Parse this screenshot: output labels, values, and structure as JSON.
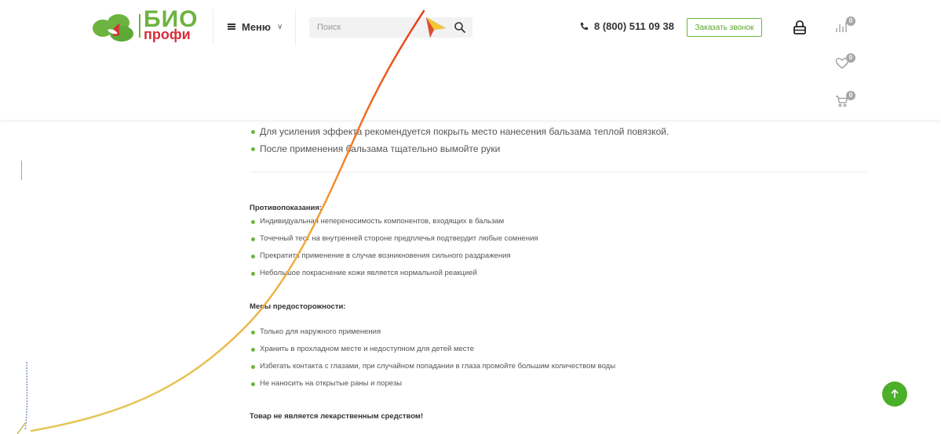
{
  "header": {
    "logo": {
      "top": "БИО",
      "bottom": "профи"
    },
    "menu": {
      "label": "Меню"
    },
    "search": {
      "placeholder": "Поиск"
    },
    "phone": "8 (800) 511 09 38",
    "call_button": "Заказать звонок",
    "compare_count": "0",
    "favorites_count": "0",
    "cart_count": "0"
  },
  "content": {
    "usage_items": [
      "Для усиления эффекта рекомендуется покрыть место нанесения бальзама теплой повязкой.",
      "После применения бальзама тщательно вымойте руки"
    ],
    "contraindications": {
      "title": "Противопоказания:",
      "items": [
        "Индивидуальная непереносимость компонентов, входящих в бальзам",
        "Точечный тест на внутренней стороне предплечья подтвердит любые сомнения",
        "Прекратить применение в случае возникновения сильного раздражения",
        "Небольшое покраснение кожи является нормальной реакцией"
      ]
    },
    "precautions": {
      "title": "Меры предосторожности:",
      "items": [
        "Только для наружного применения",
        "Хранить в прохладном месте и недоступном для детей месте",
        "Избегать контакта с глазами, при случайном попадании в глаза промойте большим количеством воды",
        "Не наносить на открытые раны и порезы"
      ]
    },
    "notice": "Товар не является лекарственным средством!"
  },
  "colors": {
    "brand_green": "#6db33f",
    "brand_red": "#d82d3a",
    "scroll_button": "#4caf2a",
    "badge": "#a6a6a6"
  },
  "icons": [
    "search-icon",
    "phone-icon",
    "lock-icon",
    "compare-icon",
    "heart-icon",
    "cart-icon",
    "arrow-up-icon",
    "cursor-icon"
  ]
}
